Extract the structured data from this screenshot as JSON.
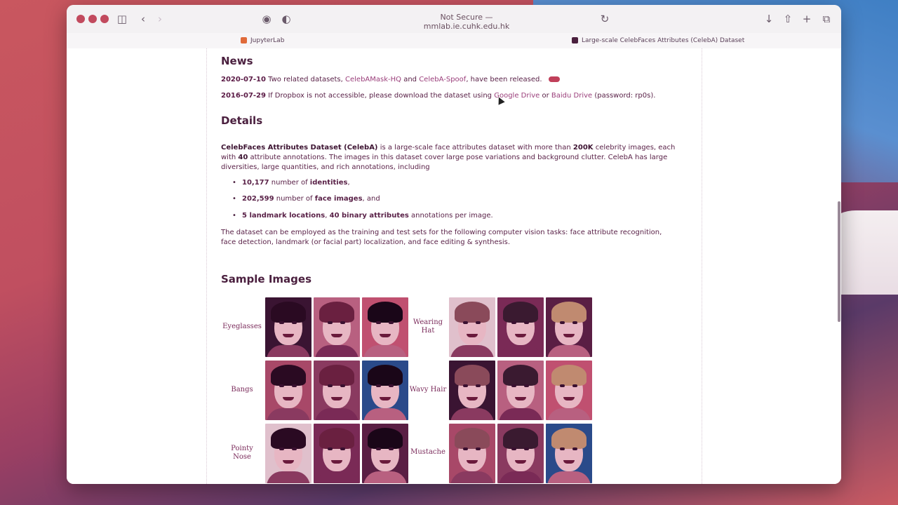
{
  "browser": {
    "url_text": "Not Secure — mmlab.ie.cuhk.edu.hk",
    "tabs": [
      {
        "label": "JupyterLab"
      },
      {
        "label": "Large-scale CelebFaces Attributes (CelebA) Dataset"
      }
    ],
    "icons": [
      "sidebar-icon",
      "back-icon",
      "forward-icon",
      "privacy-icon",
      "shield-icon",
      "reload-icon",
      "download-icon",
      "share-icon",
      "new-tab-icon",
      "tab-overview-icon"
    ]
  },
  "news": {
    "heading": "News",
    "items": [
      {
        "date": "2020-07-10",
        "text1": " Two related datasets, ",
        "link1": "CelebAMask-HQ",
        "text2": " and ",
        "link2": "CelebA-Spoof",
        "text3": ", have been released."
      },
      {
        "date": "2016-07-29",
        "text1": " If Dropbox is not accessible, please download the dataset using ",
        "link1": "Google Drive",
        "text2": " or ",
        "link2": "Baidu Drive",
        "text3": " (password: rp0s)."
      }
    ]
  },
  "details": {
    "heading": "Details",
    "intro_bold": "CelebFaces Attributes Dataset (CelebA)",
    "intro_1": " is a large-scale face attributes dataset with more than ",
    "intro_bold2": "200K",
    "intro_2": " celebrity images, each with ",
    "intro_bold3": "40",
    "intro_3": " attribute annotations. The images in this dataset cover large pose variations and background clutter. CelebA has large diversities, large quantities, and rich annotations, including",
    "facts": [
      {
        "b1": "10,177",
        "t1": " number of ",
        "b2": "identities",
        "t2": ","
      },
      {
        "b1": "202,599",
        "t1": " number of ",
        "b2": "face images",
        "t2": ", and"
      },
      {
        "b1": "5 landmark locations",
        "t1": ", ",
        "b2": "40 binary attributes",
        "t2": " annotations per image."
      }
    ],
    "outro": "The dataset can be employed as the training and test sets for the following computer vision tasks: face attribute recognition, face detection, landmark (or facial part) localization, and face editing & synthesis."
  },
  "samples": {
    "heading": "Sample Images",
    "left_labels": [
      "Eyeglasses",
      "Bangs",
      "Pointy Nose"
    ],
    "right_labels": [
      "Wearing Hat",
      "Wavy Hair",
      "Mustache"
    ]
  },
  "colors": {
    "accent": "#9a3e7a",
    "text": "#5a2248",
    "heading": "#4a1f3e"
  }
}
